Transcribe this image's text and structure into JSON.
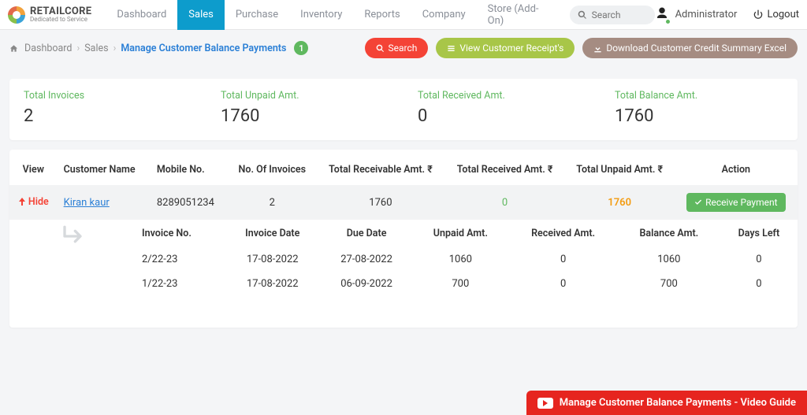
{
  "brand": {
    "name": "RETAILCORE",
    "tagline": "Dedicated to Service"
  },
  "nav": [
    "Dashboard",
    "Sales",
    "Purchase",
    "Inventory",
    "Reports",
    "Company",
    "Store (Add-On)"
  ],
  "nav_active": 1,
  "search_placeholder": "Search",
  "account_name": "Administrator",
  "logout": "Logout",
  "crumbs": {
    "home": "Dashboard",
    "mid": "Sales",
    "current": "Manage Customer Balance Payments",
    "badge": "1"
  },
  "action_buttons": {
    "search": "Search",
    "receipts": "View Customer Receipt's",
    "download": "Download Customer Credit Summary Excel"
  },
  "summary": [
    {
      "label": "Total Invoices",
      "value": "2"
    },
    {
      "label": "Total Unpaid Amt.",
      "value": "1760"
    },
    {
      "label": "Total Received Amt.",
      "value": "0"
    },
    {
      "label": "Total Balance Amt.",
      "value": "1760"
    }
  ],
  "table": {
    "headers": [
      "View",
      "Customer Name",
      "Mobile No.",
      "No. Of Invoices",
      "Total Receivable Amt. ₹",
      "Total Received Amt. ₹",
      "Total Unpaid Amt. ₹",
      "Action"
    ],
    "row": {
      "hide": "Hide",
      "name": "Kiran kaur",
      "mobile": "8289051234",
      "invoices": "2",
      "receivable": "1760",
      "received": "0",
      "unpaid": "1760",
      "action": "Receive Payment"
    },
    "detail": {
      "headers": [
        "Invoice No.",
        "Invoice Date",
        "Due Date",
        "Unpaid Amt.",
        "Received Amt.",
        "Balance Amt.",
        "Days Left"
      ],
      "rows": [
        [
          "2/22-23",
          "17-08-2022",
          "27-08-2022",
          "1060",
          "0",
          "1060",
          "0"
        ],
        [
          "1/22-23",
          "17-08-2022",
          "06-09-2022",
          "700",
          "0",
          "700",
          "0"
        ]
      ]
    }
  },
  "video_guide": "Manage Customer Balance Payments - Video Guide"
}
